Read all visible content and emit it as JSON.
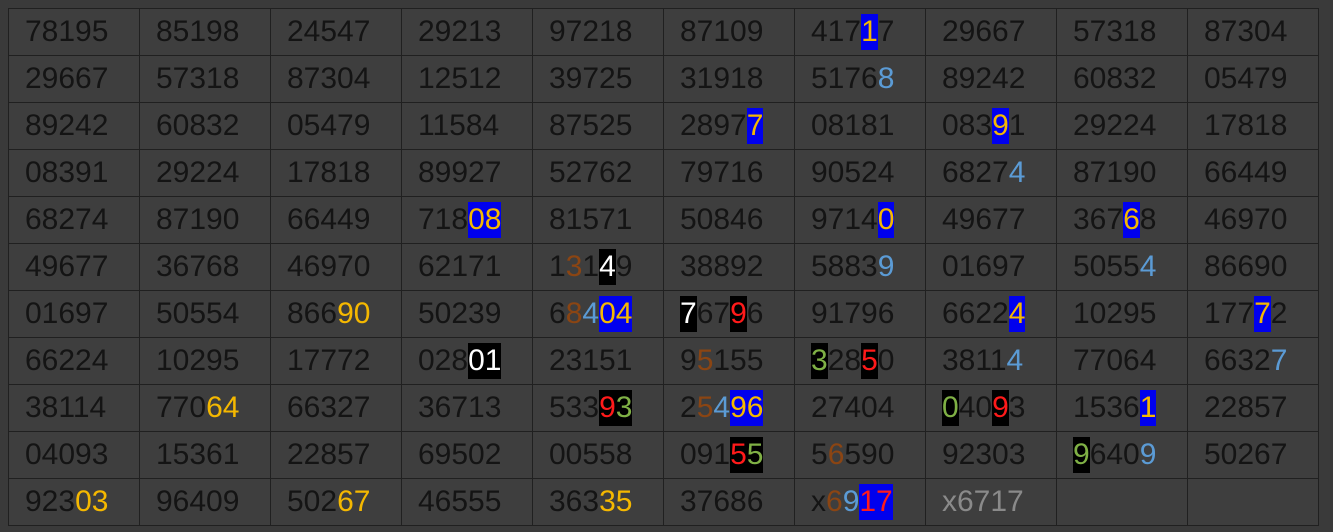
{
  "colors": {
    "background": "#3a3a3a",
    "cell": "#3e3e3e",
    "text": "#141414",
    "yellow": "#f5b800",
    "blue_text": "#5b9bd5",
    "brown": "#8b4513",
    "red": "#ff1a1a",
    "green": "#7fb045",
    "white": "#ffffff",
    "gray": "#8a8a8a",
    "blue_bg": "#0000ee",
    "black_bg": "#000000"
  },
  "grid": {
    "rows": [
      [
        [
          {
            "t": "78195"
          }
        ],
        [
          {
            "t": "85198"
          }
        ],
        [
          {
            "t": "24547"
          }
        ],
        [
          {
            "t": "29213"
          }
        ],
        [
          {
            "t": "97218"
          }
        ],
        [
          {
            "t": "87109"
          }
        ],
        [
          {
            "t": "417"
          },
          {
            "t": "1",
            "c": "#f5b800",
            "bg": "#0000ee"
          },
          {
            "t": "7"
          }
        ],
        [
          {
            "t": "29667"
          }
        ],
        [
          {
            "t": "57318"
          }
        ],
        [
          {
            "t": "87304"
          }
        ]
      ],
      [
        [
          {
            "t": "29667"
          }
        ],
        [
          {
            "t": "57318"
          }
        ],
        [
          {
            "t": "87304"
          }
        ],
        [
          {
            "t": "12512"
          }
        ],
        [
          {
            "t": "39725"
          }
        ],
        [
          {
            "t": "31918"
          }
        ],
        [
          {
            "t": "5176"
          },
          {
            "t": "8",
            "c": "#5b9bd5"
          }
        ],
        [
          {
            "t": "89242"
          }
        ],
        [
          {
            "t": "60832"
          }
        ],
        [
          {
            "t": "05479"
          }
        ]
      ],
      [
        [
          {
            "t": "89242"
          }
        ],
        [
          {
            "t": "60832"
          }
        ],
        [
          {
            "t": "05479"
          }
        ],
        [
          {
            "t": "11584"
          }
        ],
        [
          {
            "t": "87525"
          }
        ],
        [
          {
            "t": "2897"
          },
          {
            "t": "7",
            "c": "#f5b800",
            "bg": "#0000ee"
          }
        ],
        [
          {
            "t": "08181"
          }
        ],
        [
          {
            "t": "083"
          },
          {
            "t": "9",
            "c": "#f5b800",
            "bg": "#0000ee"
          },
          {
            "t": "1"
          }
        ],
        [
          {
            "t": "29224"
          }
        ],
        [
          {
            "t": "17818"
          }
        ]
      ],
      [
        [
          {
            "t": "08391"
          }
        ],
        [
          {
            "t": "29224"
          }
        ],
        [
          {
            "t": "17818"
          }
        ],
        [
          {
            "t": "89927"
          }
        ],
        [
          {
            "t": "52762"
          }
        ],
        [
          {
            "t": "79716"
          }
        ],
        [
          {
            "t": "90524"
          }
        ],
        [
          {
            "t": "6827"
          },
          {
            "t": "4",
            "c": "#5b9bd5"
          }
        ],
        [
          {
            "t": "87190"
          }
        ],
        [
          {
            "t": "66449"
          }
        ]
      ],
      [
        [
          {
            "t": "68274"
          }
        ],
        [
          {
            "t": "87190"
          }
        ],
        [
          {
            "t": "66449"
          }
        ],
        [
          {
            "t": "718"
          },
          {
            "t": "08",
            "c": "#f5b800",
            "bg": "#0000ee"
          }
        ],
        [
          {
            "t": "81571"
          }
        ],
        [
          {
            "t": "50846"
          }
        ],
        [
          {
            "t": "9714"
          },
          {
            "t": "0",
            "c": "#f5b800",
            "bg": "#0000ee"
          }
        ],
        [
          {
            "t": "49677"
          }
        ],
        [
          {
            "t": "367"
          },
          {
            "t": "6",
            "c": "#f5b800",
            "bg": "#0000ee"
          },
          {
            "t": "8"
          }
        ],
        [
          {
            "t": "46970"
          }
        ]
      ],
      [
        [
          {
            "t": "49677"
          }
        ],
        [
          {
            "t": "36768"
          }
        ],
        [
          {
            "t": "46970"
          }
        ],
        [
          {
            "t": "62171"
          }
        ],
        [
          {
            "t": "1"
          },
          {
            "t": "3",
            "c": "#8b4513"
          },
          {
            "t": "1"
          },
          {
            "t": "4",
            "c": "#ffffff",
            "bg": "#000000"
          },
          {
            "t": "9"
          }
        ],
        [
          {
            "t": "38892"
          }
        ],
        [
          {
            "t": "5883"
          },
          {
            "t": "9",
            "c": "#5b9bd5"
          }
        ],
        [
          {
            "t": "01697"
          }
        ],
        [
          {
            "t": "5055"
          },
          {
            "t": "4",
            "c": "#5b9bd5"
          }
        ],
        [
          {
            "t": "86690"
          }
        ]
      ],
      [
        [
          {
            "t": "01697"
          }
        ],
        [
          {
            "t": "50554"
          }
        ],
        [
          {
            "t": "866"
          },
          {
            "t": "90",
            "c": "#f5b800"
          }
        ],
        [
          {
            "t": "50239"
          }
        ],
        [
          {
            "t": "6"
          },
          {
            "t": "8",
            "c": "#8b4513"
          },
          {
            "t": "4",
            "c": "#5b9bd5"
          },
          {
            "t": "04",
            "c": "#f5b800",
            "bg": "#0000ee"
          }
        ],
        [
          {
            "t": "7",
            "c": "#ffffff",
            "bg": "#000000"
          },
          {
            "t": "67"
          },
          {
            "t": "9",
            "c": "#ff1a1a",
            "bg": "#000000"
          },
          {
            "t": "6"
          }
        ],
        [
          {
            "t": "91796"
          }
        ],
        [
          {
            "t": "6622"
          },
          {
            "t": "4",
            "c": "#f5b800",
            "bg": "#0000ee"
          }
        ],
        [
          {
            "t": "10295"
          }
        ],
        [
          {
            "t": "177"
          },
          {
            "t": "7",
            "c": "#f5b800",
            "bg": "#0000ee"
          },
          {
            "t": "2"
          }
        ]
      ],
      [
        [
          {
            "t": "66224"
          }
        ],
        [
          {
            "t": "10295"
          }
        ],
        [
          {
            "t": "17772"
          }
        ],
        [
          {
            "t": "028"
          },
          {
            "t": "01",
            "c": "#ffffff",
            "bg": "#000000"
          }
        ],
        [
          {
            "t": "23151"
          }
        ],
        [
          {
            "t": "9"
          },
          {
            "t": "5",
            "c": "#8b4513"
          },
          {
            "t": "155"
          }
        ],
        [
          {
            "t": "3",
            "c": "#7fb045",
            "bg": "#000000"
          },
          {
            "t": "28"
          },
          {
            "t": "5",
            "c": "#ff1a1a",
            "bg": "#000000"
          },
          {
            "t": "0"
          }
        ],
        [
          {
            "t": "3811"
          },
          {
            "t": "4",
            "c": "#5b9bd5"
          }
        ],
        [
          {
            "t": "77064"
          }
        ],
        [
          {
            "t": "6632"
          },
          {
            "t": "7",
            "c": "#5b9bd5"
          }
        ]
      ],
      [
        [
          {
            "t": "38114"
          }
        ],
        [
          {
            "t": "770"
          },
          {
            "t": "64",
            "c": "#f5b800"
          }
        ],
        [
          {
            "t": "66327"
          }
        ],
        [
          {
            "t": "36713"
          }
        ],
        [
          {
            "t": "533"
          },
          {
            "t": "9",
            "c": "#ff1a1a",
            "bg": "#000000"
          },
          {
            "t": "3",
            "c": "#7fb045",
            "bg": "#000000"
          }
        ],
        [
          {
            "t": "2"
          },
          {
            "t": "5",
            "c": "#8b4513"
          },
          {
            "t": "4",
            "c": "#5b9bd5"
          },
          {
            "t": "96",
            "c": "#f5b800",
            "bg": "#0000ee"
          }
        ],
        [
          {
            "t": "27404"
          }
        ],
        [
          {
            "t": "0",
            "c": "#7fb045",
            "bg": "#000000"
          },
          {
            "t": "40"
          },
          {
            "t": "9",
            "c": "#ff1a1a",
            "bg": "#000000"
          },
          {
            "t": "3"
          }
        ],
        [
          {
            "t": "1536"
          },
          {
            "t": "1",
            "c": "#f5b800",
            "bg": "#0000ee"
          }
        ],
        [
          {
            "t": "22857"
          }
        ]
      ],
      [
        [
          {
            "t": "04093"
          }
        ],
        [
          {
            "t": "15361"
          }
        ],
        [
          {
            "t": "22857"
          }
        ],
        [
          {
            "t": "69502"
          }
        ],
        [
          {
            "t": "00558"
          }
        ],
        [
          {
            "t": "091"
          },
          {
            "t": "5",
            "c": "#ff1a1a",
            "bg": "#000000"
          },
          {
            "t": "5",
            "c": "#7fb045",
            "bg": "#000000"
          }
        ],
        [
          {
            "t": "5"
          },
          {
            "t": "6",
            "c": "#8b4513"
          },
          {
            "t": "590"
          }
        ],
        [
          {
            "t": "92303"
          }
        ],
        [
          {
            "t": "9",
            "c": "#7fb045",
            "bg": "#000000"
          },
          {
            "t": "640"
          },
          {
            "t": "9",
            "c": "#5b9bd5"
          }
        ],
        [
          {
            "t": "50267"
          }
        ]
      ],
      [
        [
          {
            "t": "923"
          },
          {
            "t": "03",
            "c": "#f5b800"
          }
        ],
        [
          {
            "t": "96409"
          }
        ],
        [
          {
            "t": "502"
          },
          {
            "t": "67",
            "c": "#f5b800"
          }
        ],
        [
          {
            "t": "46555"
          }
        ],
        [
          {
            "t": "363"
          },
          {
            "t": "35",
            "c": "#f5b800"
          }
        ],
        [
          {
            "t": "37686"
          }
        ],
        [
          {
            "t": "x"
          },
          {
            "t": "6",
            "c": "#8b4513"
          },
          {
            "t": "9",
            "c": "#5b9bd5"
          },
          {
            "t": "17",
            "c": "#ff1a1a",
            "bg": "#0000ee"
          }
        ],
        [
          {
            "t": "x6717",
            "c": "#8a8a8a"
          }
        ],
        [],
        []
      ]
    ]
  }
}
